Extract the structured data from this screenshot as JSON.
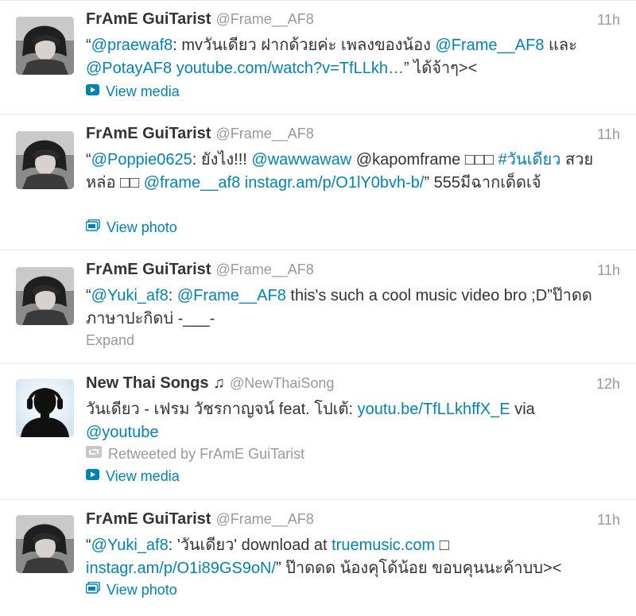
{
  "tweets": [
    {
      "name": "FrAmE GuiTarist",
      "handle": "@Frame__AF8",
      "time": "11h",
      "segments": [
        {
          "t": "“"
        },
        {
          "t": "@praewaf8",
          "link": true
        },
        {
          "t": ": mvวันเดียว ฝากด้วยค่ะ เพลงของน้อง "
        },
        {
          "t": "@Frame__AF8",
          "link": true
        },
        {
          "t": " และ "
        },
        {
          "t": "@PotayAF8",
          "link": true
        },
        {
          "t": " "
        },
        {
          "t": "youtube.com/watch?v=TfLLkh…",
          "link": true
        },
        {
          "t": "” ได้จ้าๆ><"
        }
      ],
      "action": "View media",
      "action_icon": "play-icon"
    },
    {
      "name": "FrAmE GuiTarist",
      "handle": "@Frame__AF8",
      "time": "11h",
      "segments": [
        {
          "t": "“"
        },
        {
          "t": "@Poppie0625",
          "link": true
        },
        {
          "t": ": ยังไง!!! "
        },
        {
          "t": "@wawwawaw",
          "link": true
        },
        {
          "t": " @kapomframe □□□ "
        },
        {
          "t": "#วันเดียว",
          "link": true
        },
        {
          "t": " สวยหล่อ □□ "
        },
        {
          "t": "@frame__af8",
          "link": true
        },
        {
          "t": " "
        },
        {
          "t": "instagr.am/p/O1lY0bvh-b/",
          "link": true
        },
        {
          "t": "” 555มีฉากเด็ดเจ้"
        }
      ],
      "action": "View photo",
      "action_icon": "photo-icon"
    },
    {
      "name": "FrAmE GuiTarist",
      "handle": "@Frame__AF8",
      "time": "11h",
      "segments": [
        {
          "t": "“"
        },
        {
          "t": "@Yuki_af8",
          "link": true
        },
        {
          "t": ": "
        },
        {
          "t": "@Frame__AF8",
          "link": true
        },
        {
          "t": " this's such a cool music video bro ;D”ป๊าดด ภาษาปะกิดบ่ -___-"
        }
      ],
      "expand": "Expand"
    },
    {
      "name": "New Thai Songs ♫",
      "handle": "@NewThaiSong",
      "time": "12h",
      "segments": [
        {
          "t": "วันเดียว - เฟรม วัชรกาญจน์ feat. โปเต้: "
        },
        {
          "t": "youtu.be/TfLLkhffX_E",
          "link": true
        },
        {
          "t": " via "
        },
        {
          "t": "@youtube",
          "link": true
        }
      ],
      "retweeted_by": "Retweeted by FrAmE GuiTarist",
      "action": "View media",
      "action_icon": "play-icon"
    },
    {
      "name": "FrAmE GuiTarist",
      "handle": "@Frame__AF8",
      "time": "11h",
      "segments": [
        {
          "t": "“"
        },
        {
          "t": "@Yuki_af8",
          "link": true
        },
        {
          "t": ": 'วันเดียว' download at "
        },
        {
          "t": "truemusic.com",
          "link": true
        },
        {
          "t": " □ "
        },
        {
          "t": "instagr.am/p/O1i89GS9oN/",
          "link": true
        },
        {
          "t": "” ป๊าดดด น้องคุโด้น้อย ขอบคุนนะค้าบบ><"
        }
      ],
      "action": "View photo",
      "action_icon": "photo-icon"
    }
  ],
  "colors": {
    "link": "#0084b4",
    "muted": "#999999",
    "text": "#333333",
    "divider": "#e8e8e8"
  }
}
